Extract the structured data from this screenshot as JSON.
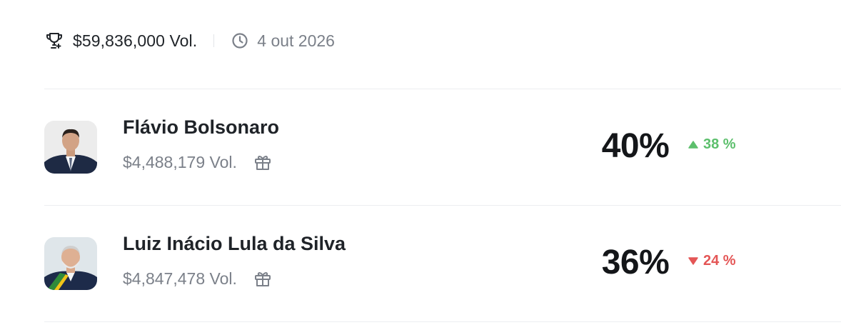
{
  "header": {
    "total_volume": "$59,836,000 Vol.",
    "end_date": "4 out 2026",
    "trophy_icon": "trophy-icon",
    "clock_icon": "clock-icon"
  },
  "outcomes": [
    {
      "name": "Flávio Bolsonaro",
      "volume": "$4,488,179 Vol.",
      "probability": "40%",
      "change": "38 %",
      "change_direction": "up",
      "gift_icon": "gift-icon"
    },
    {
      "name": "Luiz Inácio Lula da Silva",
      "volume": "$4,847,478 Vol.",
      "probability": "36%",
      "change": "24 %",
      "change_direction": "down",
      "gift_icon": "gift-icon"
    }
  ],
  "colors": {
    "up": "#5cbf6c",
    "down": "#e45656",
    "muted_text": "#7b8089",
    "divider": "#eceef1"
  }
}
